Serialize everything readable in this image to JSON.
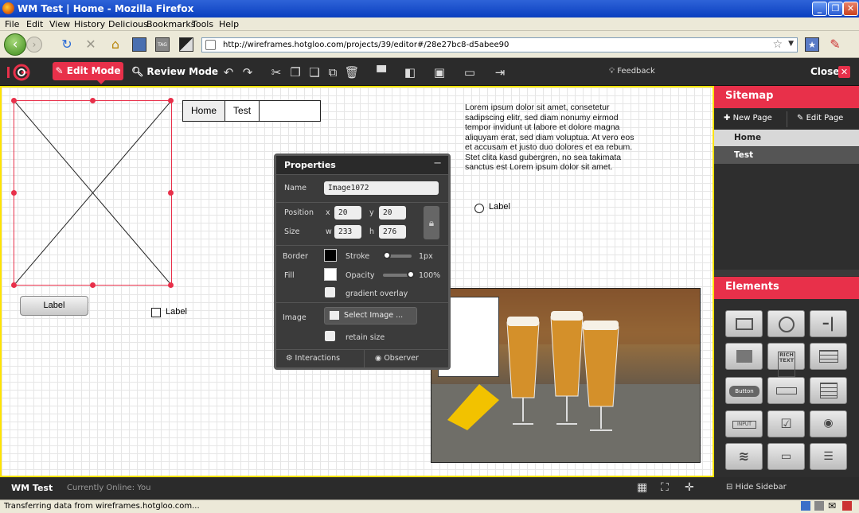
{
  "window": {
    "title": "WM Test | Home - Mozilla Firefox"
  },
  "menu": [
    "File",
    "Edit",
    "View",
    "History",
    "Delicious",
    "Bookmarks",
    "Tools",
    "Help"
  ],
  "url": "http://wireframes.hotgloo.com/projects/39/editor#/28e27bc8-d5abee90",
  "toolbar": {
    "edit_mode": "Edit Mode",
    "review_mode": "Review Mode",
    "feedback": "Feedback",
    "close": "Close"
  },
  "canvas": {
    "tabs": [
      "Home",
      "Test"
    ],
    "lorem": "Lorem ipsum dolor sit amet, consetetur sadipscing elitr, sed diam nonumy eirmod tempor invidunt ut labore et dolore magna aliquyam erat, sed diam voluptua. At vero eos et accusam et justo duo dolores et ea rebum. Stet clita kasd gubergren, no sea takimata sanctus est Lorem ipsum dolor sit amet.",
    "radio_label": "Label",
    "checkbox_label": "Label",
    "button_label": "Label"
  },
  "properties": {
    "title": "Properties",
    "name_label": "Name",
    "name_value": "Image1072",
    "position_label": "Position",
    "x_label": "x",
    "x_value": "20",
    "y_label": "y",
    "y_value": "20",
    "size_label": "Size",
    "w_label": "w",
    "w_value": "233",
    "h_label": "h",
    "h_value": "276",
    "border_label": "Border",
    "stroke_label": "Stroke",
    "stroke_value": "1px",
    "fill_label": "Fill",
    "opacity_label": "Opacity",
    "opacity_value": "100%",
    "gradient_label": "gradient overlay",
    "image_label": "Image",
    "select_image": "Select Image ...",
    "retain_label": "retain size",
    "interactions": "Interactions",
    "observer": "Observer"
  },
  "sidebar": {
    "sitemap_title": "Sitemap",
    "new_page": "New Page",
    "edit_page": "Edit Page",
    "pages": [
      "Home",
      "Test"
    ],
    "elements_title": "Elements",
    "element_labels": {
      "rich_text": "RICH TEXT",
      "button": "Button",
      "input": "INPUT"
    }
  },
  "footer": {
    "project": "WM Test",
    "online": "Currently Online: You",
    "hide_sidebar": "Hide Sidebar"
  },
  "status": "Transferring data from wireframes.hotgloo.com...",
  "colors": {
    "accent": "#e8304a",
    "canvas_border": "#ffe300",
    "dark": "#2b2b2b"
  }
}
